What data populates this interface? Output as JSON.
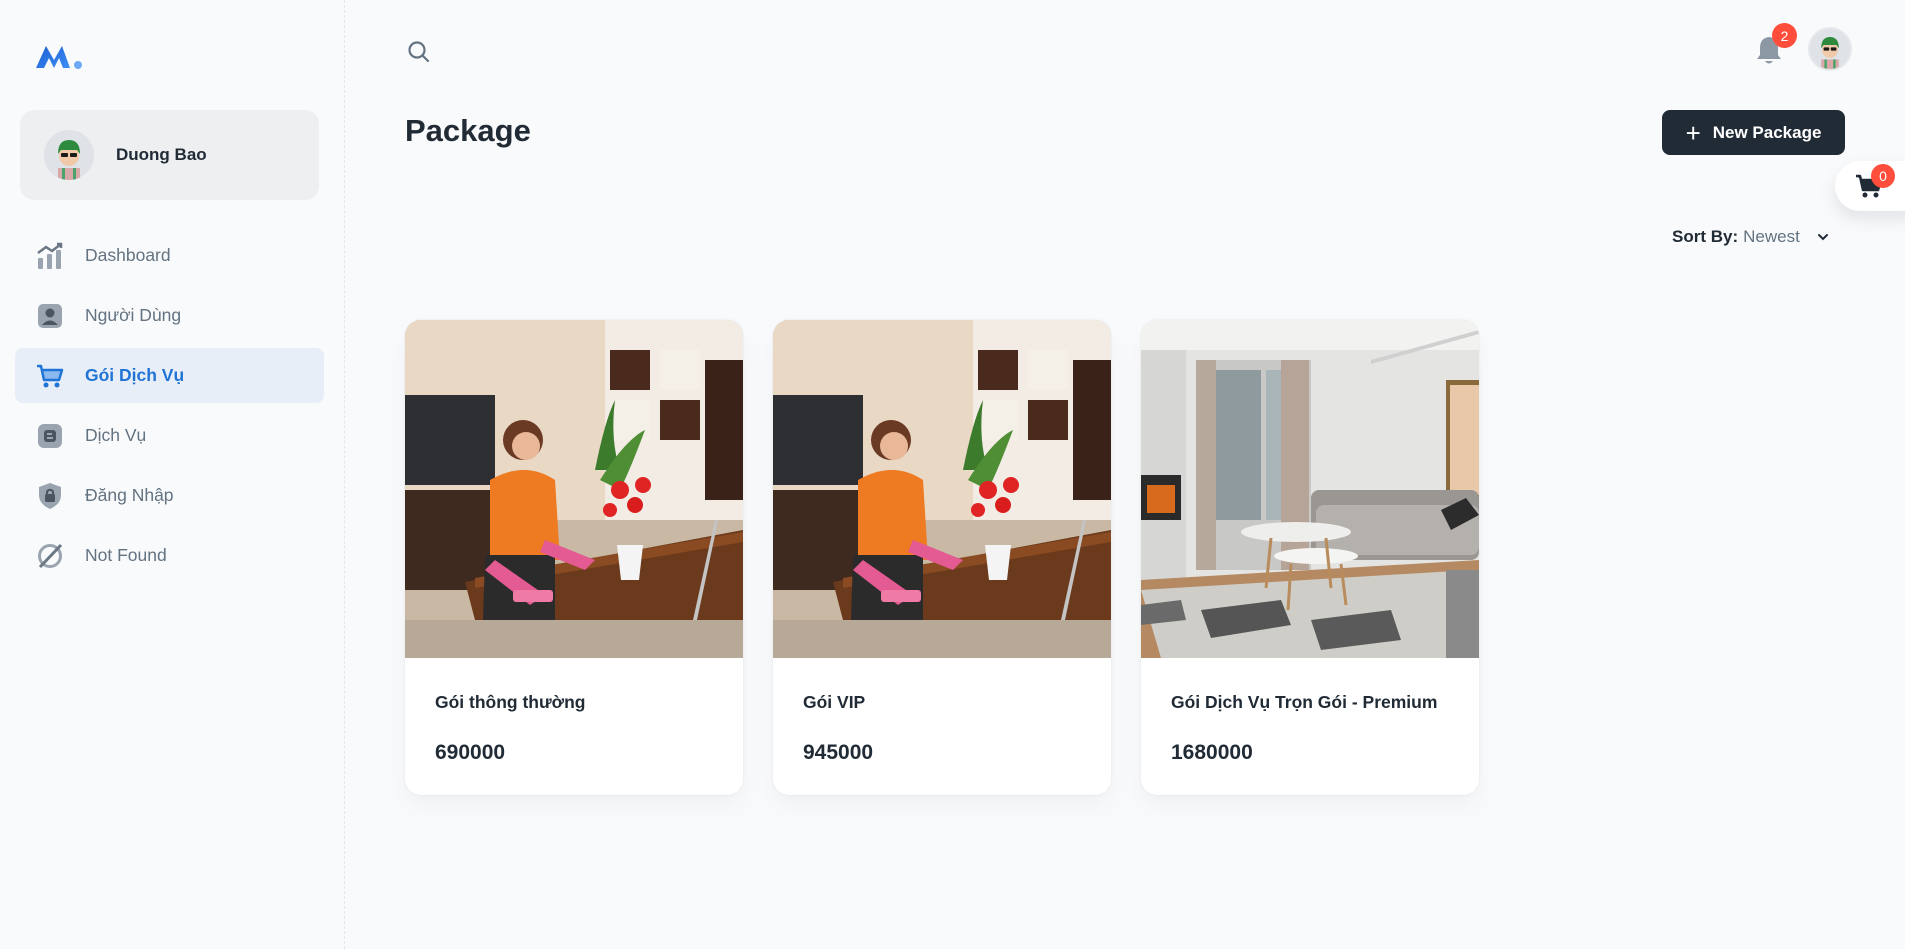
{
  "user": {
    "name": "Duong Bao"
  },
  "sidebar": {
    "items": [
      {
        "label": "Dashboard",
        "icon": "chart-icon",
        "active": false
      },
      {
        "label": "Người Dùng",
        "icon": "user-icon",
        "active": false
      },
      {
        "label": "Gói Dịch Vụ",
        "icon": "cart-icon",
        "active": true
      },
      {
        "label": "Dịch Vụ",
        "icon": "blog-icon",
        "active": false
      },
      {
        "label": "Đăng Nhập",
        "icon": "lock-icon",
        "active": false
      },
      {
        "label": "Not Found",
        "icon": "disabled-icon",
        "active": false
      }
    ]
  },
  "header": {
    "notification_count": "2"
  },
  "page": {
    "title": "Package",
    "new_button_label": "New Package",
    "cart_count": "0",
    "sort": {
      "label": "Sort By:",
      "value": "Newest"
    }
  },
  "packages": [
    {
      "title": "Gói thông thường",
      "price": "690000",
      "image": "cleaner-wiping-table"
    },
    {
      "title": "Gói VIP",
      "price": "945000",
      "image": "cleaner-wiping-table"
    },
    {
      "title": "Gói Dịch Vụ Trọn Gói - Premium",
      "price": "1680000",
      "image": "modern-living-room"
    }
  ],
  "colors": {
    "accent": "#1f74d6",
    "dark_button": "#212b36",
    "badge": "#ff4f3c",
    "active_bg": "#e7eef8"
  }
}
